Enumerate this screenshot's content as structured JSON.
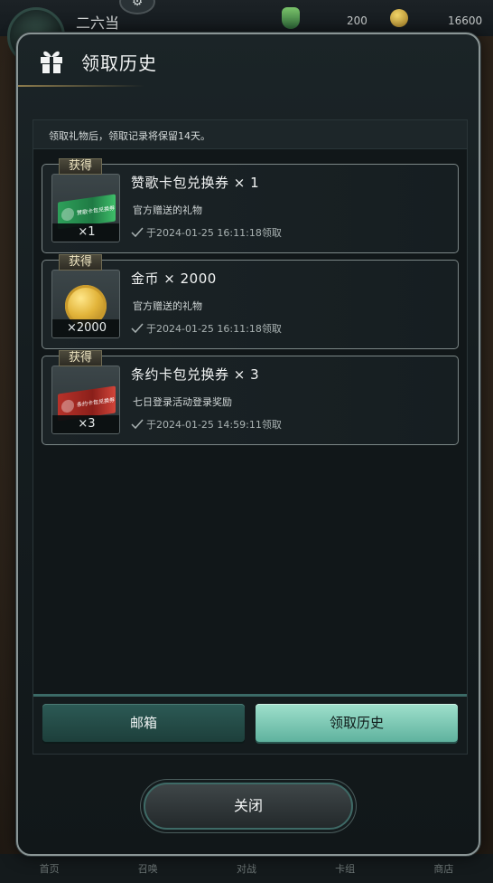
{
  "background": {
    "player_name": "二六当",
    "resource_1_value": "200",
    "resource_2_value": "16600",
    "nav": [
      "首页",
      "召唤",
      "对战",
      "卡组",
      "商店"
    ]
  },
  "dialog": {
    "title": "领取历史",
    "notice": "领取礼物后，领取记录将保留14天。",
    "obtain_label": "获得",
    "records": [
      {
        "name": "赞歌卡包兑换券 × 1",
        "qty": "×1",
        "desc": "官方赠送的礼物",
        "time": "于2024-01-25  16:11:18领取",
        "ticket_text": "赞歌卡包兑换券",
        "icon": "green-ticket-icon"
      },
      {
        "name": "金币 × 2000",
        "qty": "×2000",
        "desc": "官方赠送的礼物",
        "time": "于2024-01-25  16:11:18领取",
        "icon": "gold-coin-icon"
      },
      {
        "name": "条约卡包兑换券 × 3",
        "qty": "×3",
        "desc": "七日登录活动登录奖励",
        "time": "于2024-01-25  14:59:11领取",
        "ticket_text": "条约卡包兑换券",
        "icon": "red-ticket-icon"
      }
    ],
    "tabs": {
      "mail": "邮箱",
      "history": "领取历史",
      "active": "history"
    },
    "close_label": "关闭"
  },
  "colors": {
    "accent_teal": "#5fb29e",
    "panel_bg": "#111719",
    "border": "#8a9595",
    "gold": "#e2b43a"
  }
}
